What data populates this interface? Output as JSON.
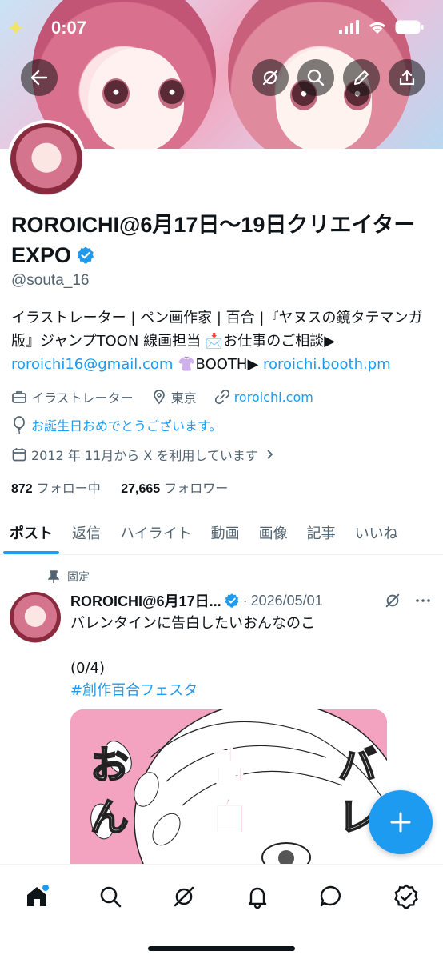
{
  "status_bar": {
    "time": "0:07"
  },
  "profile": {
    "display_name": "ROROICHI@6月17日〜19日クリエイターEXPO",
    "handle": "@souta_16",
    "bio_line1": "イラストレーター | ペン画作家 | 百合 |『ヤヌスの鏡タテマンガ版』ジャンプTOON 線画担当 📩お仕事のご相談▶",
    "bio_email": "roroichi16@gmail.com",
    "bio_mid": " 👚BOOTH▶ ",
    "bio_booth": "roroichi.booth.pm",
    "category": "イラストレーター",
    "location": "東京",
    "website": "roroichi.com",
    "birthday": "お誕生日おめでとうございます。",
    "joined": "2012 年 11月から X を利用しています",
    "following_count": "872",
    "following_label": "フォロー中",
    "followers_count": "27,665",
    "followers_label": "フォロワー"
  },
  "tabs": [
    "ポスト",
    "返信",
    "ハイライト",
    "動画",
    "画像",
    "記事",
    "いいね"
  ],
  "pinned_post": {
    "pinned_label": "固定",
    "author": "ROROICHI@6月17日...",
    "date": "2026/05/01",
    "text_line1": "バレンタインに告白したいおんなのこ",
    "text_line2": "(0/4)",
    "hashtag": "#創作百合フェスタ",
    "image_text": [
      "お",
      "ん",
      "告",
      "白",
      "バ",
      "レ"
    ]
  },
  "colors": {
    "accent": "#1d9bf0",
    "text": "#0f1419",
    "secondary": "#536471"
  }
}
